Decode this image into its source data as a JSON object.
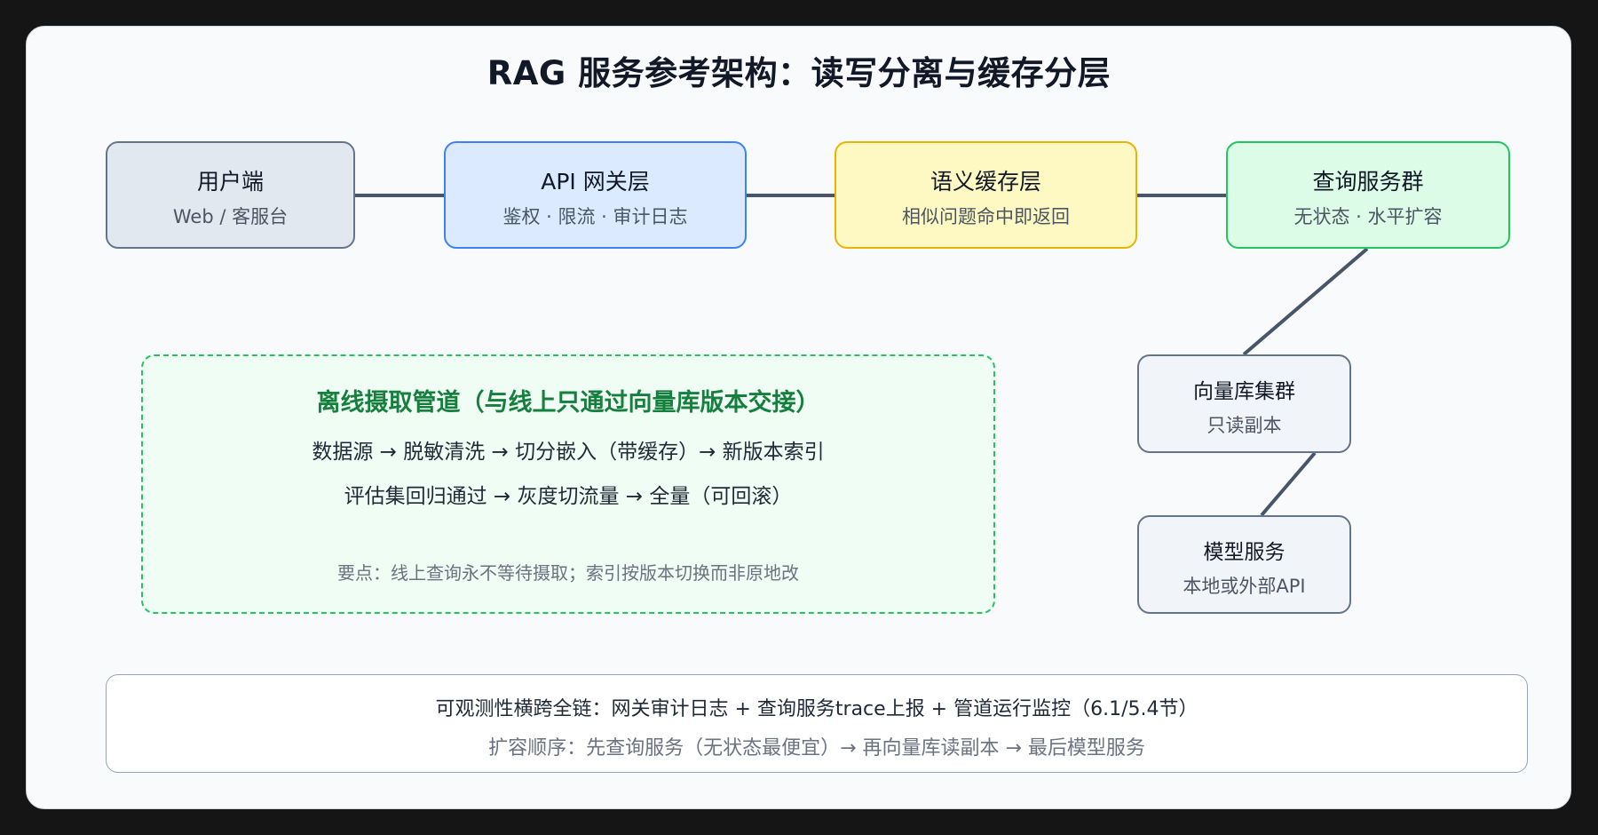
{
  "title": "RAG 服务参考架构：读写分离与缓存分层",
  "colors": {
    "client_fill": "#e2e8f0",
    "client_border": "#64748b",
    "gateway_fill": "#dbeafe",
    "gateway_border": "#3b82f6",
    "cache_fill": "#fef9c3",
    "cache_border": "#eab308",
    "query_fill": "#dcfce7",
    "query_border": "#22c55e",
    "side_fill": "#f1f5f9",
    "side_border": "#64748b",
    "connector": "#475569",
    "pipeline_title": "#15803d"
  },
  "nodes": {
    "client": {
      "title": "用户端",
      "subtitle": "Web / 客服台"
    },
    "gateway": {
      "title": "API 网关层",
      "subtitle": "鉴权 · 限流 · 审计日志"
    },
    "cache": {
      "title": "语义缓存层",
      "subtitle": "相似问题命中即返回"
    },
    "query": {
      "title": "查询服务群",
      "subtitle": "无状态 · 水平扩容"
    },
    "vector": {
      "title": "向量库集群",
      "subtitle": "只读副本"
    },
    "model": {
      "title": "模型服务",
      "subtitle": "本地或外部API"
    }
  },
  "pipeline": {
    "title": "离线摄取管道（与线上只通过向量库版本交接）",
    "line1": "数据源 → 脱敏清洗 → 切分嵌入（带缓存）→ 新版本索引",
    "line2": "评估集回归通过 → 灰度切流量 → 全量（可回滚）",
    "note": "要点：线上查询永不等待摄取；索引按版本切换而非原地改"
  },
  "footer": {
    "line1": "可观测性横跨全链：网关审计日志 + 查询服务trace上报 + 管道运行监控（6.1/5.4节）",
    "line2": "扩容顺序：先查询服务（无状态最便宜）→ 再向量库读副本 → 最后模型服务"
  }
}
